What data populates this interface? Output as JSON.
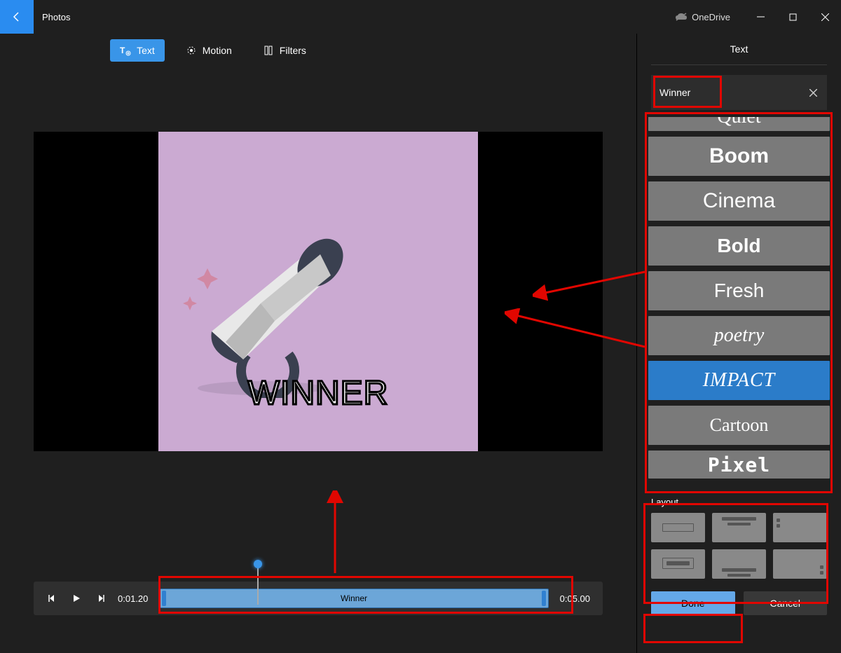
{
  "titlebar": {
    "app_title": "Photos",
    "onedrive_label": "OneDrive"
  },
  "top_tabs": {
    "text": "Text",
    "motion": "Motion",
    "filters": "Filters"
  },
  "preview": {
    "overlay_text": "WINNER"
  },
  "timeline": {
    "current_time": "0:01.20",
    "total_time": "0:05.00",
    "clip_label": "Winner"
  },
  "right_panel": {
    "header": "Text",
    "input_value": "Winner",
    "styles": {
      "quiet": "Quiet",
      "boom": "Boom",
      "cinema": "Cinema",
      "bold": "Bold",
      "fresh": "Fresh",
      "poetry": "poetry",
      "impact": "IMPACT",
      "cartoon": "Cartoon",
      "pixel": "Pixel"
    },
    "layout_label": "Layout",
    "done": "Done",
    "cancel": "Cancel"
  }
}
